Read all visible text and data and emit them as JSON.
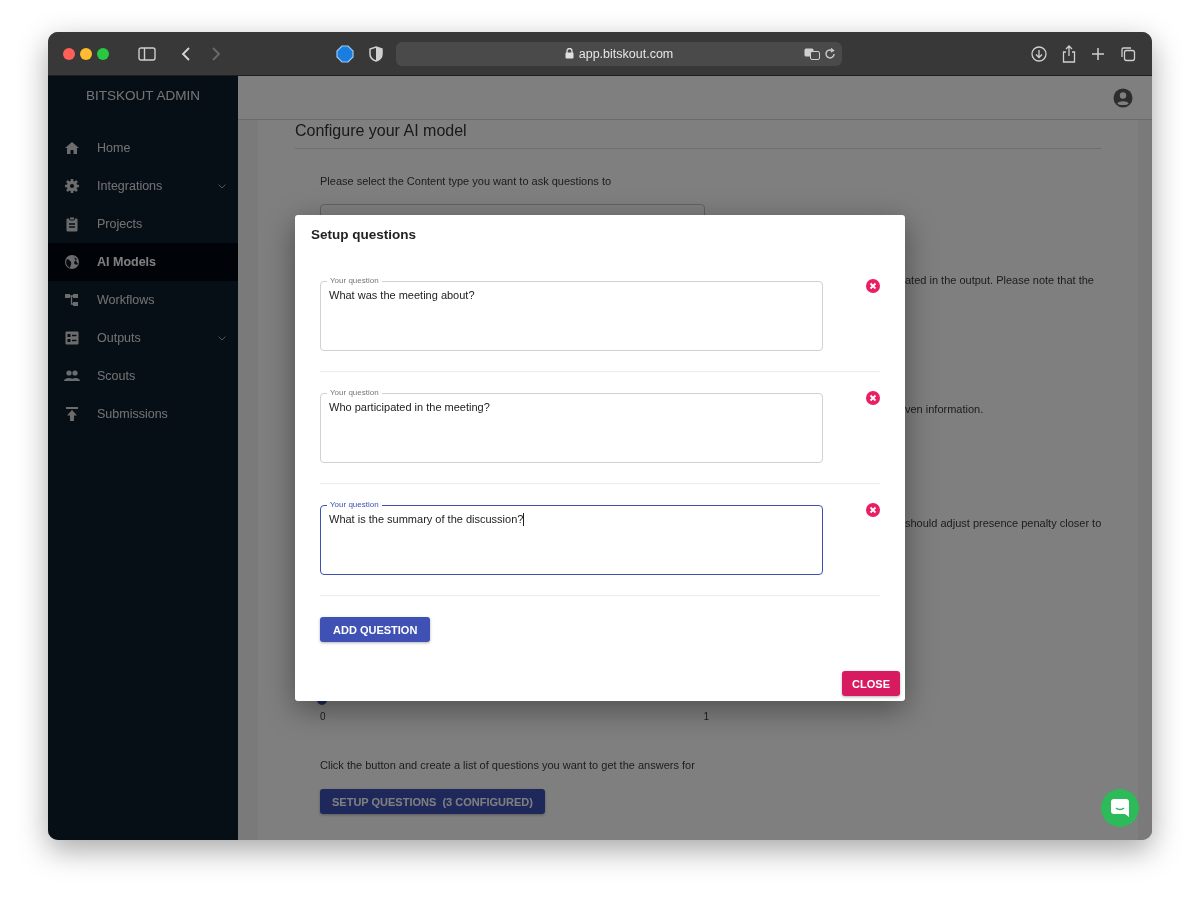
{
  "browser": {
    "url": "app.bitskout.com"
  },
  "sidebar": {
    "title": "BITSKOUT ADMIN",
    "items": [
      {
        "label": "Home",
        "selected": false,
        "has_submenu": false
      },
      {
        "label": "Integrations",
        "selected": false,
        "has_submenu": true
      },
      {
        "label": "Projects",
        "selected": false,
        "has_submenu": false
      },
      {
        "label": "AI Models",
        "selected": true,
        "has_submenu": false
      },
      {
        "label": "Workflows",
        "selected": false,
        "has_submenu": false
      },
      {
        "label": "Outputs",
        "selected": false,
        "has_submenu": true
      },
      {
        "label": "Scouts",
        "selected": false,
        "has_submenu": false
      },
      {
        "label": "Submissions",
        "selected": false,
        "has_submenu": false
      }
    ]
  },
  "page": {
    "title": "Configure your AI model",
    "content_type_prompt": "Please select the Content type you want to ask questions to",
    "partial_texts": [
      "ated in the output. Please note that the",
      "ven information.",
      "should adjust presence penalty closer to"
    ],
    "slider": {
      "level": 0,
      "min_label": "0",
      "max_label": "1"
    },
    "setup_prompt": "Click the button and create a list of questions you want to get the answers for",
    "setup_button": "SETUP QUESTIONS  (3 CONFIGURED)"
  },
  "dialog": {
    "title": "Setup questions",
    "questions": [
      {
        "label": "Your question",
        "value": "What was the meeting about?",
        "focused": false
      },
      {
        "label": "Your question",
        "value": "Who participated in the meeting?",
        "focused": false
      },
      {
        "label": "Your question",
        "value": "What is the summary of the discussion?",
        "focused": true
      }
    ],
    "add_button": "ADD QUESTION",
    "close_button": "CLOSE"
  }
}
